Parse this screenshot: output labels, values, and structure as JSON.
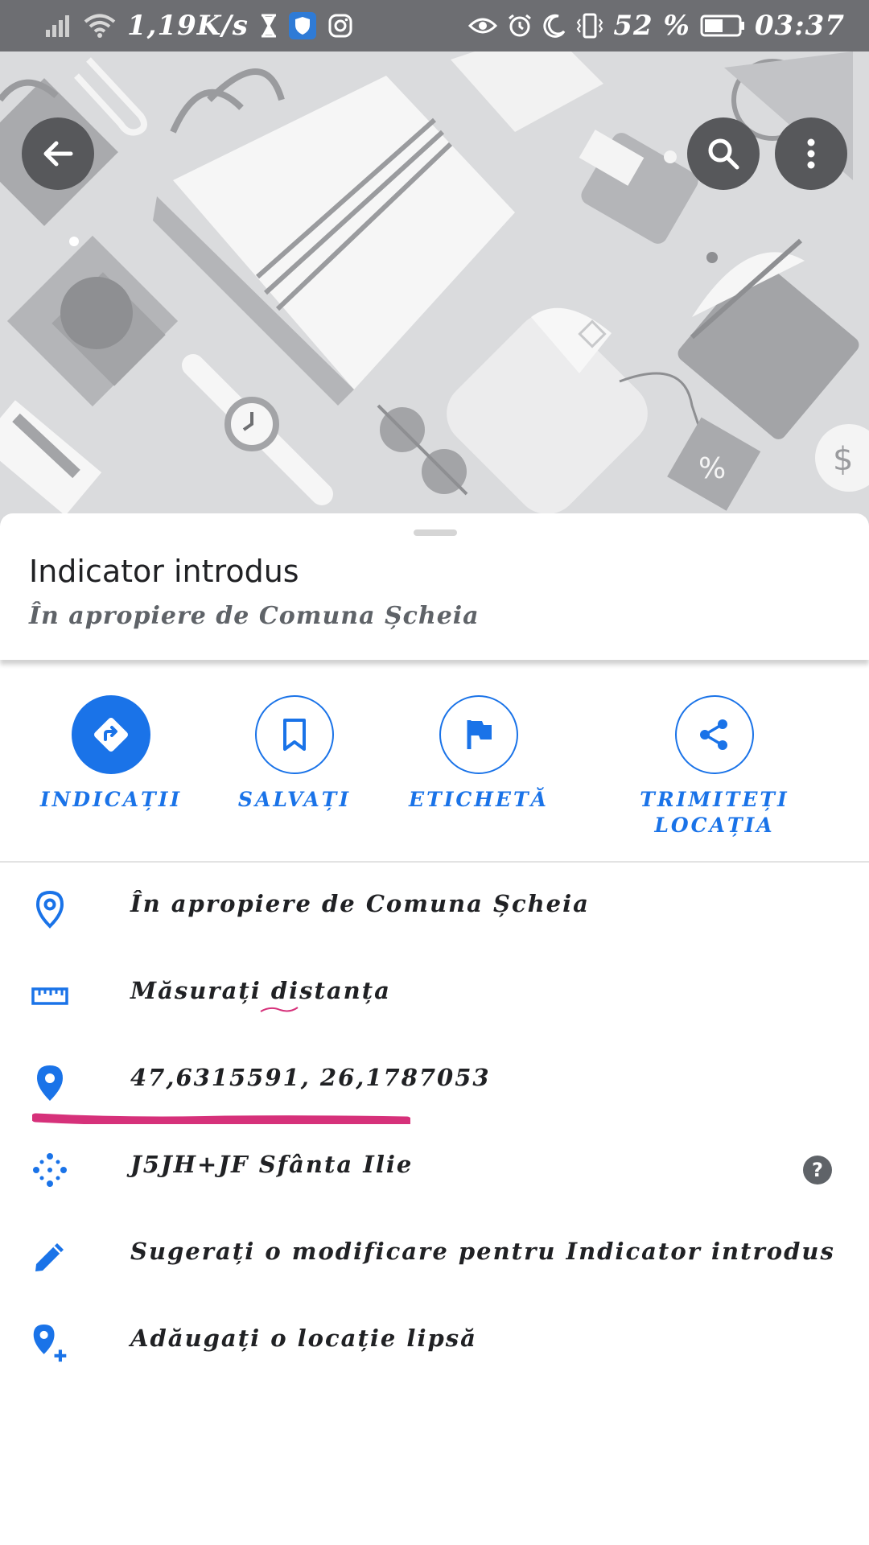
{
  "status_bar": {
    "net_speed": "1,19K/s",
    "battery": "52 %",
    "time": "03:37",
    "icons_left": [
      "signal-icon",
      "wifi-icon",
      "hourglass-icon",
      "shield-icon",
      "instagram-icon"
    ],
    "icons_right": [
      "eye-icon",
      "alarm-icon",
      "moon-icon",
      "vibrate-icon",
      "battery-icon"
    ]
  },
  "header": {
    "buttons": [
      "back-arrow-icon",
      "search-icon",
      "more-vert-icon"
    ]
  },
  "place": {
    "title": "Indicator introdus",
    "subtitle": "În apropiere de Comuna Șcheia"
  },
  "actions": [
    {
      "label": "INDICAȚII",
      "icon": "directions-icon"
    },
    {
      "label": "SALVAȚI",
      "icon": "bookmark-icon"
    },
    {
      "label": "ETICHETĂ",
      "icon": "flag-icon"
    },
    {
      "label_line1": "TRIMITEȚI",
      "label_line2": "LOCAȚIA",
      "icon": "share-icon"
    }
  ],
  "info": [
    {
      "text": "În apropiere de Comuna Șcheia",
      "icon": "location-outline-icon"
    },
    {
      "text": "Măsurați distanța",
      "icon": "ruler-icon"
    },
    {
      "text": "47,6315591, 26,1787053",
      "icon": "location-filled-icon"
    },
    {
      "text": "J5JH+JF Sfânta Ilie",
      "icon": "plus-code-icon",
      "help": "?"
    },
    {
      "text": "Sugerați o modificare pentru Indicator introdus",
      "icon": "edit-icon"
    },
    {
      "text": "Adăugați o locație lipsă",
      "icon": "add-location-icon"
    }
  ],
  "colors": {
    "accent": "#1a73e8",
    "status_bar": "#6d6e72",
    "hero_bg": "#dadbdd",
    "highlight": "#d6317a"
  }
}
